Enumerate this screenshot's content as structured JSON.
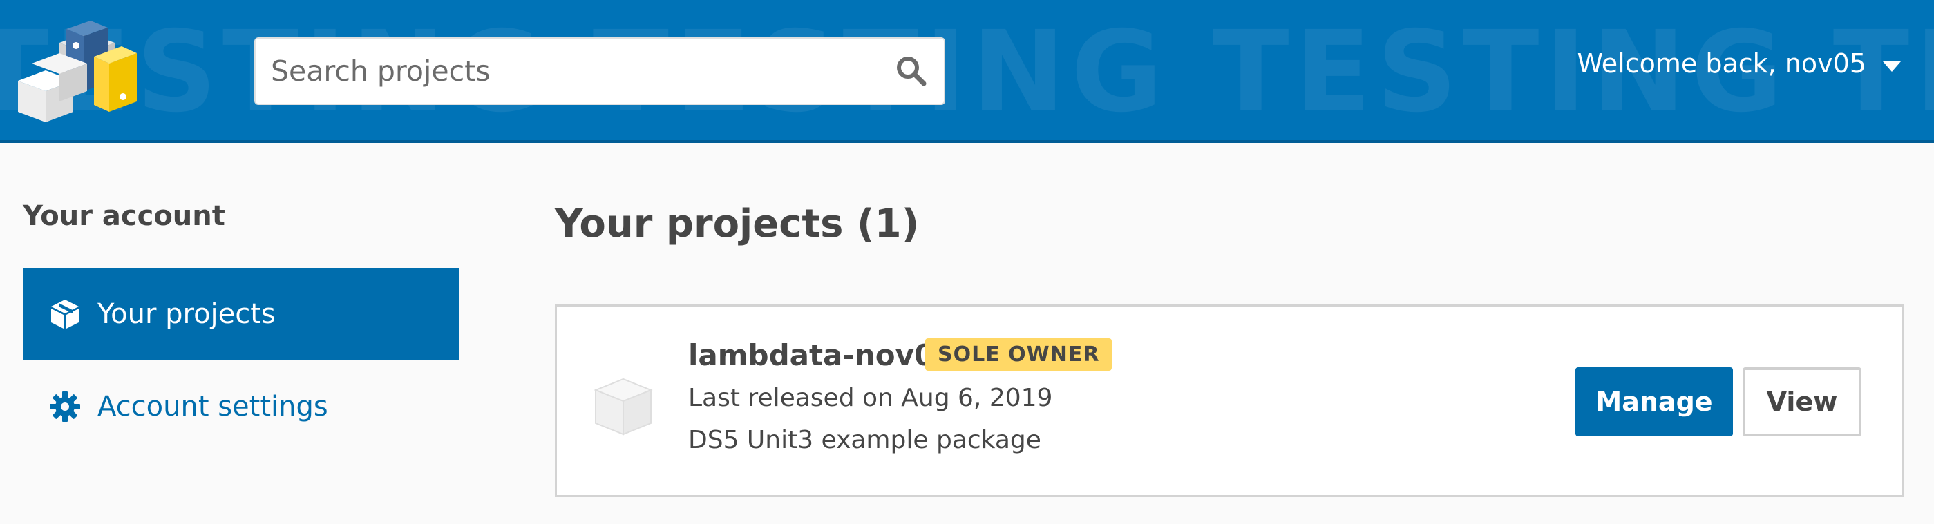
{
  "header": {
    "watermark": "TESTING TESTING TESTING TESTING TESTING",
    "search": {
      "placeholder": "Search projects",
      "value": ""
    },
    "user_menu": {
      "label": "Welcome back, nov05"
    }
  },
  "sidebar": {
    "title": "Your account",
    "items": [
      {
        "label": "Your projects",
        "icon": "package-icon",
        "active": true
      },
      {
        "label": "Account settings",
        "icon": "gear-icon",
        "active": false
      }
    ]
  },
  "main": {
    "title": "Your projects (1)",
    "projects": [
      {
        "name": "lambdata-nov05",
        "badge": "SOLE OWNER",
        "released": "Last released on Aug 6, 2019",
        "summary": "DS5 Unit3 example package",
        "manage_label": "Manage",
        "view_label": "View"
      }
    ]
  },
  "colors": {
    "header_bg": "#0073b7",
    "accent": "#006dad",
    "badge_bg": "#ffd866",
    "page_bg": "#fafafa"
  }
}
